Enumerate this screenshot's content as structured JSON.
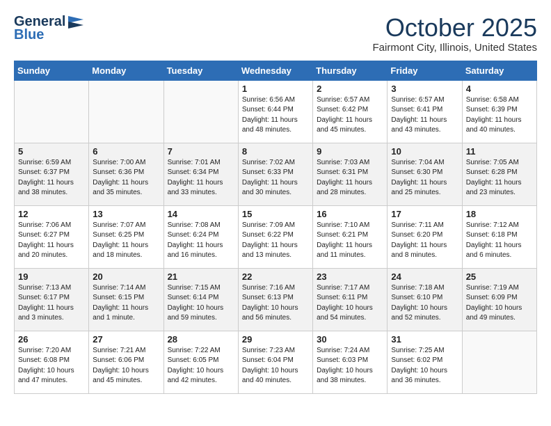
{
  "header": {
    "logo_general": "General",
    "logo_blue": "Blue",
    "month": "October 2025",
    "location": "Fairmont City, Illinois, United States"
  },
  "days_of_week": [
    "Sunday",
    "Monday",
    "Tuesday",
    "Wednesday",
    "Thursday",
    "Friday",
    "Saturday"
  ],
  "weeks": [
    [
      {
        "day": "",
        "info": ""
      },
      {
        "day": "",
        "info": ""
      },
      {
        "day": "",
        "info": ""
      },
      {
        "day": "1",
        "info": "Sunrise: 6:56 AM\nSunset: 6:44 PM\nDaylight: 11 hours\nand 48 minutes."
      },
      {
        "day": "2",
        "info": "Sunrise: 6:57 AM\nSunset: 6:42 PM\nDaylight: 11 hours\nand 45 minutes."
      },
      {
        "day": "3",
        "info": "Sunrise: 6:57 AM\nSunset: 6:41 PM\nDaylight: 11 hours\nand 43 minutes."
      },
      {
        "day": "4",
        "info": "Sunrise: 6:58 AM\nSunset: 6:39 PM\nDaylight: 11 hours\nand 40 minutes."
      }
    ],
    [
      {
        "day": "5",
        "info": "Sunrise: 6:59 AM\nSunset: 6:37 PM\nDaylight: 11 hours\nand 38 minutes."
      },
      {
        "day": "6",
        "info": "Sunrise: 7:00 AM\nSunset: 6:36 PM\nDaylight: 11 hours\nand 35 minutes."
      },
      {
        "day": "7",
        "info": "Sunrise: 7:01 AM\nSunset: 6:34 PM\nDaylight: 11 hours\nand 33 minutes."
      },
      {
        "day": "8",
        "info": "Sunrise: 7:02 AM\nSunset: 6:33 PM\nDaylight: 11 hours\nand 30 minutes."
      },
      {
        "day": "9",
        "info": "Sunrise: 7:03 AM\nSunset: 6:31 PM\nDaylight: 11 hours\nand 28 minutes."
      },
      {
        "day": "10",
        "info": "Sunrise: 7:04 AM\nSunset: 6:30 PM\nDaylight: 11 hours\nand 25 minutes."
      },
      {
        "day": "11",
        "info": "Sunrise: 7:05 AM\nSunset: 6:28 PM\nDaylight: 11 hours\nand 23 minutes."
      }
    ],
    [
      {
        "day": "12",
        "info": "Sunrise: 7:06 AM\nSunset: 6:27 PM\nDaylight: 11 hours\nand 20 minutes."
      },
      {
        "day": "13",
        "info": "Sunrise: 7:07 AM\nSunset: 6:25 PM\nDaylight: 11 hours\nand 18 minutes."
      },
      {
        "day": "14",
        "info": "Sunrise: 7:08 AM\nSunset: 6:24 PM\nDaylight: 11 hours\nand 16 minutes."
      },
      {
        "day": "15",
        "info": "Sunrise: 7:09 AM\nSunset: 6:22 PM\nDaylight: 11 hours\nand 13 minutes."
      },
      {
        "day": "16",
        "info": "Sunrise: 7:10 AM\nSunset: 6:21 PM\nDaylight: 11 hours\nand 11 minutes."
      },
      {
        "day": "17",
        "info": "Sunrise: 7:11 AM\nSunset: 6:20 PM\nDaylight: 11 hours\nand 8 minutes."
      },
      {
        "day": "18",
        "info": "Sunrise: 7:12 AM\nSunset: 6:18 PM\nDaylight: 11 hours\nand 6 minutes."
      }
    ],
    [
      {
        "day": "19",
        "info": "Sunrise: 7:13 AM\nSunset: 6:17 PM\nDaylight: 11 hours\nand 3 minutes."
      },
      {
        "day": "20",
        "info": "Sunrise: 7:14 AM\nSunset: 6:15 PM\nDaylight: 11 hours\nand 1 minute."
      },
      {
        "day": "21",
        "info": "Sunrise: 7:15 AM\nSunset: 6:14 PM\nDaylight: 10 hours\nand 59 minutes."
      },
      {
        "day": "22",
        "info": "Sunrise: 7:16 AM\nSunset: 6:13 PM\nDaylight: 10 hours\nand 56 minutes."
      },
      {
        "day": "23",
        "info": "Sunrise: 7:17 AM\nSunset: 6:11 PM\nDaylight: 10 hours\nand 54 minutes."
      },
      {
        "day": "24",
        "info": "Sunrise: 7:18 AM\nSunset: 6:10 PM\nDaylight: 10 hours\nand 52 minutes."
      },
      {
        "day": "25",
        "info": "Sunrise: 7:19 AM\nSunset: 6:09 PM\nDaylight: 10 hours\nand 49 minutes."
      }
    ],
    [
      {
        "day": "26",
        "info": "Sunrise: 7:20 AM\nSunset: 6:08 PM\nDaylight: 10 hours\nand 47 minutes."
      },
      {
        "day": "27",
        "info": "Sunrise: 7:21 AM\nSunset: 6:06 PM\nDaylight: 10 hours\nand 45 minutes."
      },
      {
        "day": "28",
        "info": "Sunrise: 7:22 AM\nSunset: 6:05 PM\nDaylight: 10 hours\nand 42 minutes."
      },
      {
        "day": "29",
        "info": "Sunrise: 7:23 AM\nSunset: 6:04 PM\nDaylight: 10 hours\nand 40 minutes."
      },
      {
        "day": "30",
        "info": "Sunrise: 7:24 AM\nSunset: 6:03 PM\nDaylight: 10 hours\nand 38 minutes."
      },
      {
        "day": "31",
        "info": "Sunrise: 7:25 AM\nSunset: 6:02 PM\nDaylight: 10 hours\nand 36 minutes."
      },
      {
        "day": "",
        "info": ""
      }
    ]
  ]
}
